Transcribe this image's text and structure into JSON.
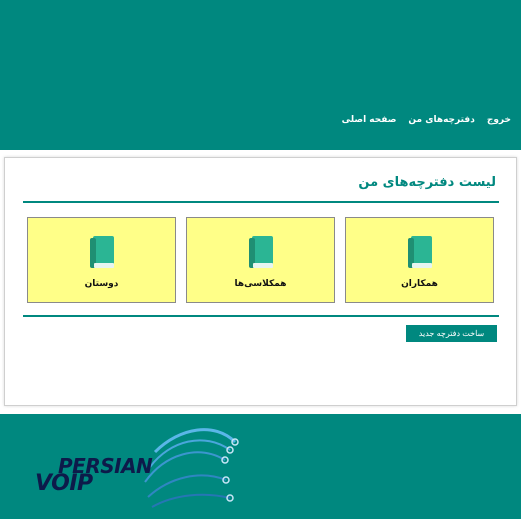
{
  "nav": {
    "home": "صفحه اصلی",
    "my_notebooks": "دفترچه‌های من",
    "logout": "خروج"
  },
  "page": {
    "title": "لیست دفترچه‌های من"
  },
  "notebooks": [
    {
      "label": "همکاران",
      "icon": "book-icon"
    },
    {
      "label": "همکلاسی‌ها",
      "icon": "book-icon"
    },
    {
      "label": "دوستان",
      "icon": "book-icon"
    }
  ],
  "actions": {
    "new_notebook": "ساخت دفترچه جدید"
  },
  "footer": {
    "logo_line1": "PERSIAN",
    "logo_line2": "VOIP"
  },
  "colors": {
    "brand": "#00887f",
    "card_bg": "#ffff88",
    "book_icon": "#2bb594"
  }
}
